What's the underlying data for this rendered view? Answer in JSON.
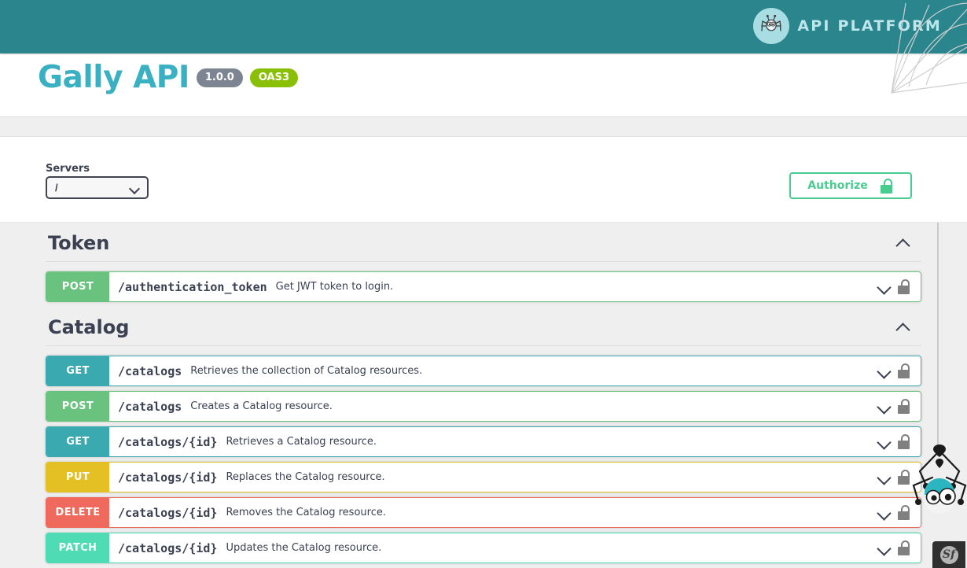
{
  "header": {
    "brand_name": "API PLATFORM",
    "brand_icon": "spider-robot-icon",
    "background_color": "#2a858d"
  },
  "info": {
    "title": "Gally API",
    "version_badge": "1.0.0",
    "spec_badge": "OAS3",
    "title_color": "#3ab0c3"
  },
  "scheme": {
    "servers_label": "Servers",
    "selected_server": "/",
    "authorize_label": "Authorize",
    "authorize_icon": "unlock-icon",
    "authorize_color": "#49cc90"
  },
  "tags": [
    {
      "name": "Token",
      "collapse_icon": "chevron-up-icon",
      "operations": [
        {
          "method": "POST",
          "color": "#69c27e",
          "path": "/authentication_token",
          "summary": "Get JWT token to login.",
          "expand_icon": "chevron-down-icon",
          "lock_icon": "unlock-icon"
        }
      ]
    },
    {
      "name": "Catalog",
      "collapse_icon": "chevron-up-icon",
      "operations": [
        {
          "method": "GET",
          "color": "#3aaab0",
          "path": "/catalogs",
          "summary": "Retrieves the collection of Catalog resources.",
          "expand_icon": "chevron-down-icon",
          "lock_icon": "unlock-icon"
        },
        {
          "method": "POST",
          "color": "#69c27e",
          "path": "/catalogs",
          "summary": "Creates a Catalog resource.",
          "expand_icon": "chevron-down-icon",
          "lock_icon": "unlock-icon"
        },
        {
          "method": "GET",
          "color": "#3aaab0",
          "path": "/catalogs/{id}",
          "summary": "Retrieves a Catalog resource.",
          "expand_icon": "chevron-down-icon",
          "lock_icon": "unlock-icon"
        },
        {
          "method": "PUT",
          "color": "#e4c024",
          "path": "/catalogs/{id}",
          "summary": "Replaces the Catalog resource.",
          "expand_icon": "chevron-down-icon",
          "lock_icon": "unlock-icon"
        },
        {
          "method": "DELETE",
          "color": "#ef6a5c",
          "path": "/catalogs/{id}",
          "summary": "Removes the Catalog resource.",
          "expand_icon": "chevron-down-icon",
          "lock_icon": "unlock-icon"
        },
        {
          "method": "PATCH",
          "color": "#4fdcb5",
          "path": "/catalogs/{id}",
          "summary": "Updates the Catalog resource.",
          "expand_icon": "chevron-down-icon",
          "lock_icon": "unlock-icon"
        }
      ]
    }
  ],
  "debug_toolbar": {
    "framework_label": "Sf"
  }
}
